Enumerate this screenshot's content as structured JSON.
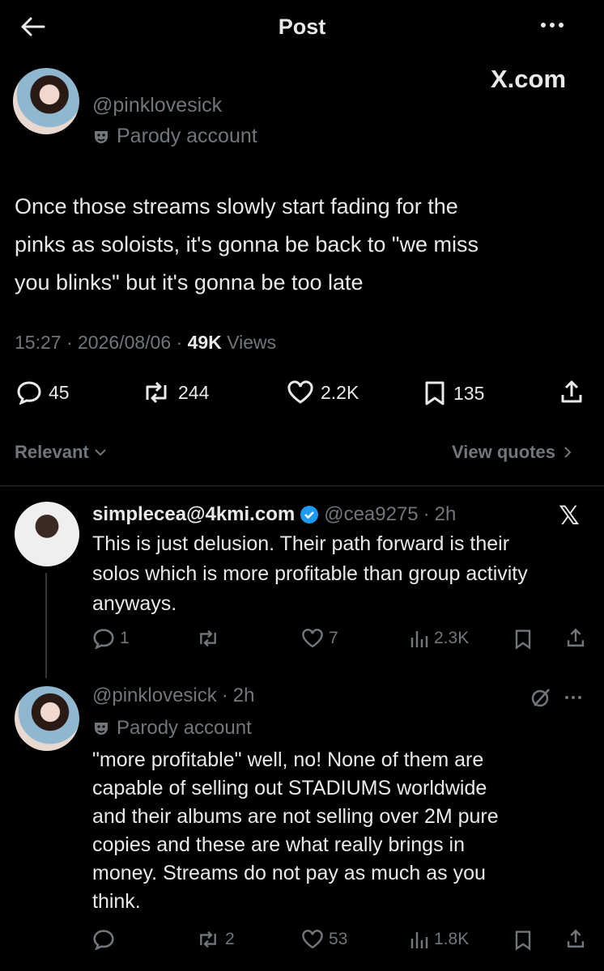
{
  "header": {
    "title": "Post",
    "watermark": "X.com"
  },
  "main_post": {
    "handle": "@pinklovesick",
    "parody_label": "Parody account",
    "text_lines": [
      "Once those streams slowly start fading for the",
      "pinks as soloists, it's gonna be back to \"we miss",
      "you blinks\" but it's gonna be too late"
    ],
    "time": "15:27",
    "date": "2026/08/06",
    "views_count": "49K",
    "views_label": "Views",
    "sep": "·",
    "replies": "45",
    "reposts": "244",
    "likes": "2.2K",
    "bookmarks": "135"
  },
  "filter": {
    "sort_label": "Relevant",
    "quotes_label": "View quotes"
  },
  "reply1": {
    "name": "simplecea@4kmi.com",
    "handle": "@cea9275",
    "time": "2h",
    "text_lines": [
      "This is just delusion. Their path forward is their",
      "solos which is more profitable than group activity",
      "anyways."
    ],
    "replies": "1",
    "likes": "7",
    "views": "2.3K"
  },
  "reply2": {
    "handle": "@pinklovesick",
    "time": "2h",
    "parody_label": "Parody account",
    "text_lines": [
      "\"more profitable\" well, no! None of them are",
      "capable of selling out STADIUMS worldwide",
      "and their albums are not selling over 2M pure",
      "copies and these are what really brings in",
      "money. Streams do not pay as much as you",
      "think."
    ],
    "reposts": "2",
    "likes": "53",
    "views": "1.8K"
  },
  "colors": {
    "background": "#000000",
    "text": "#e7e9ea",
    "muted": "#71767b",
    "verified": "#1d9bf0"
  }
}
